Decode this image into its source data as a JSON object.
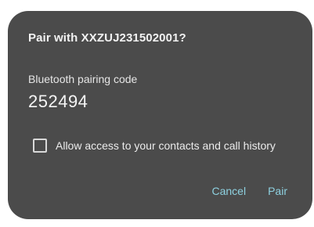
{
  "dialog": {
    "title": "Pair with XXZUJ231502001?",
    "code_label": "Bluetooth pairing code",
    "code_value": "252494",
    "checkbox_label": "Allow access to your contacts and call history",
    "checkbox_checked": false,
    "cancel_label": "Cancel",
    "pair_label": "Pair"
  },
  "colors": {
    "dialog_bg": "#4b4b4b",
    "text_primary": "#f2f2f2",
    "accent": "#8ed1e0"
  }
}
